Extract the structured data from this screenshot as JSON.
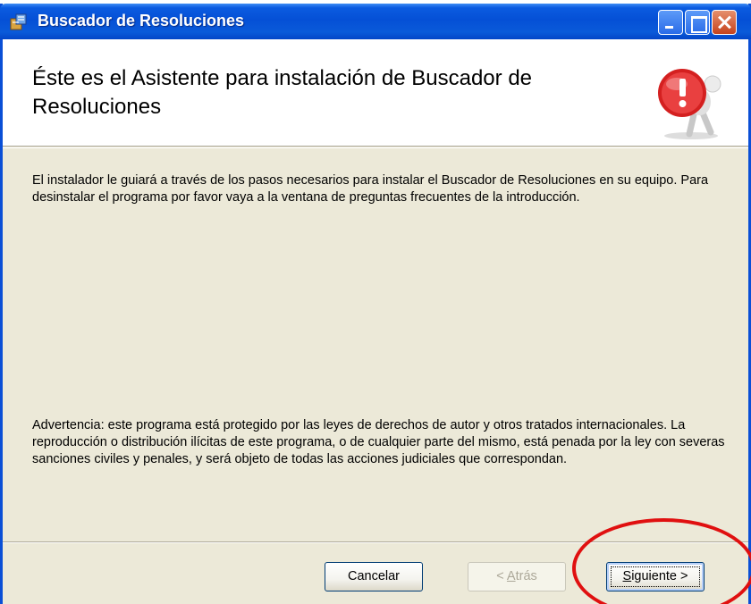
{
  "window": {
    "title": "Buscador de Resoluciones"
  },
  "header": {
    "title": "Éste es el Asistente para instalación de Buscador de Resoluciones"
  },
  "content": {
    "intro": "El instalador le guiará a través de los pasos necesarios para instalar el Buscador de Resoluciones en su equipo. Para desinstalar el programa por favor vaya a la ventana de preguntas frecuentes de la introducción.",
    "warning": "Advertencia: este programa está protegido por las leyes de derechos de autor y otros tratados internacionales. La reproducción o distribución ilícitas de este programa, o de cualquier parte del mismo, está penada por la ley con severas sanciones civiles y penales, y será objeto de todas las acciones judiciales que correspondan."
  },
  "buttons": {
    "cancel": "Cancelar",
    "back_prefix": "< ",
    "back_accel": "A",
    "back_rest": "trás",
    "next_accel": "S",
    "next_rest": "iguiente >"
  },
  "icons": {
    "app": "installer-package-icon",
    "logo": "red-figure-exclamation-icon"
  },
  "colors": {
    "titlebar": "#0550d6",
    "dialog_bg": "#ece9d8",
    "highlight": "#e01010"
  }
}
